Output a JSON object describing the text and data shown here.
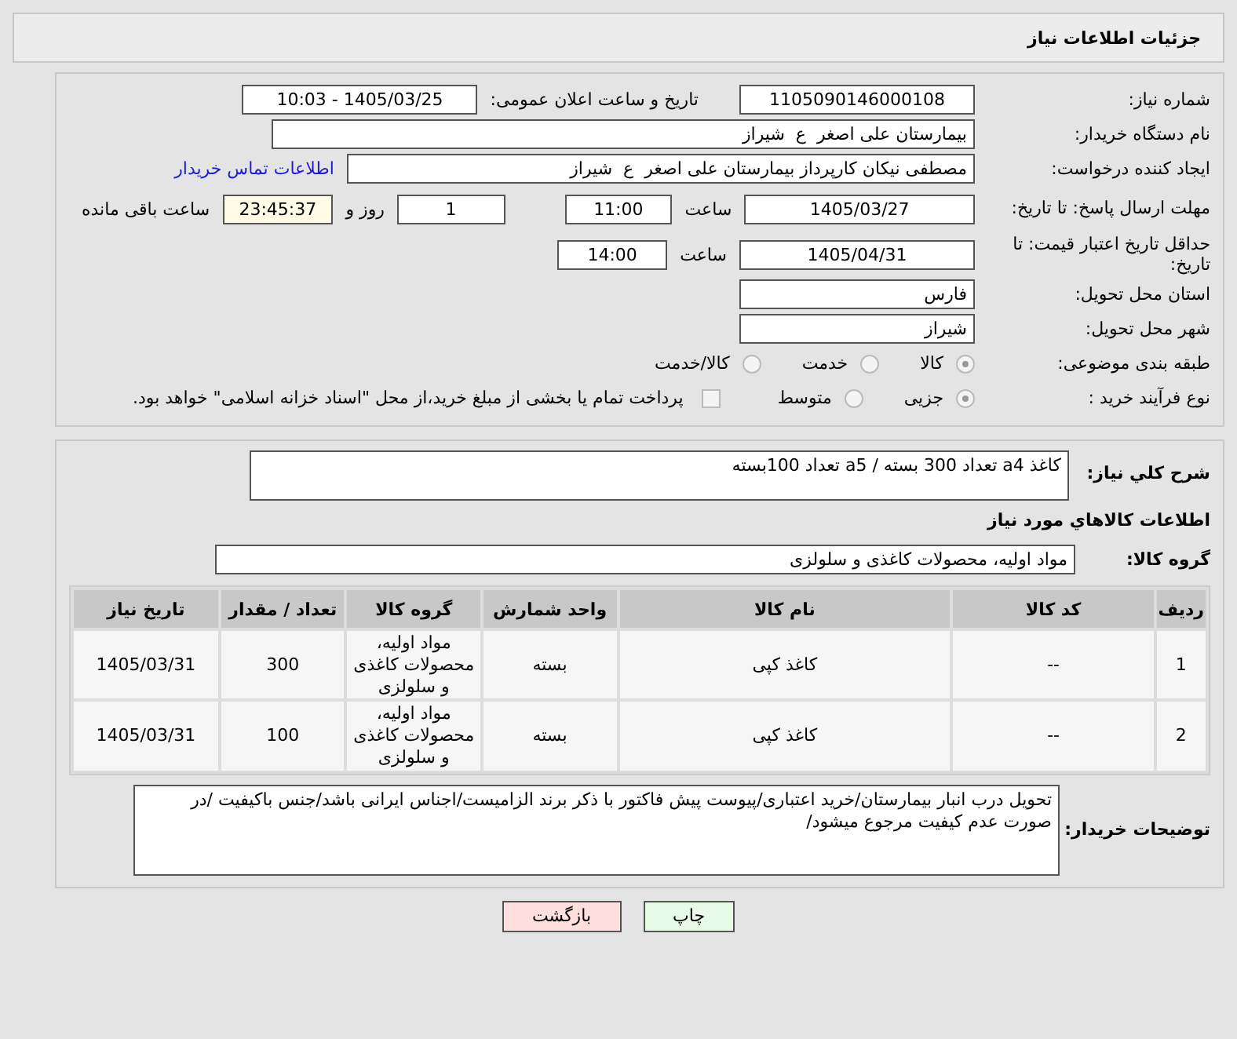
{
  "title": "جزئیات اطلاعات نیاز",
  "need_number": {
    "label": "شماره نیاز:",
    "value": "1105090146000108"
  },
  "announce": {
    "label": "تاریخ و ساعت اعلان عمومی:",
    "value": "1405/03/25 - 10:03"
  },
  "buyer": {
    "label": "نام دستگاه خریدار:",
    "value": "بیمارستان علی اصغر  ع  شیراز"
  },
  "requester": {
    "label": "ایجاد کننده درخواست:",
    "value": "مصطفی نیکان کارپرداز بیمارستان علی اصغر  ع  شیراز",
    "link": "اطلاعات تماس خریدار"
  },
  "deadline": {
    "label": "مهلت ارسال پاسخ: تا تاریخ:",
    "date": "1405/03/27",
    "time_label": "ساعت",
    "time": "11:00",
    "days": "1",
    "days_label": "روز و",
    "remaining": "23:45:37",
    "remaining_label": "ساعت باقی مانده"
  },
  "validity": {
    "label": "حداقل تاریخ اعتبار قیمت: تا تاریخ:",
    "date": "1405/04/31",
    "time_label": "ساعت",
    "time": "14:00"
  },
  "province": {
    "label": "استان محل تحویل:",
    "value": "فارس"
  },
  "city": {
    "label": "شهر محل تحویل:",
    "value": "شیراز"
  },
  "category": {
    "label": "طبقه بندی موضوعی:",
    "options": [
      {
        "label": "کالا",
        "selected": true
      },
      {
        "label": "خدمت",
        "selected": false
      },
      {
        "label": "کالا/خدمت",
        "selected": false
      }
    ]
  },
  "process": {
    "label": "نوع فرآیند خرید :",
    "options": [
      {
        "label": "جزیی",
        "selected": true
      },
      {
        "label": "متوسط",
        "selected": false
      }
    ],
    "payment": {
      "label": "پرداخت تمام یا بخشی از مبلغ خرید،از محل \"اسناد خزانه اسلامی\" خواهد بود.",
      "checked": false
    }
  },
  "description": {
    "label": "شرح کلي نياز:",
    "value": "کاغذ a4  تعداد 300 بسته / a5  تعداد 100بسته"
  },
  "goods_heading": "اطلاعات کالاهاي مورد نياز",
  "goods_group": {
    "label": "گروه کالا:",
    "value": "مواد اولیه، محصولات کاغذی و سلولزی"
  },
  "table": {
    "columns": [
      "ردیف",
      "کد کالا",
      "نام کالا",
      "واحد شمارش",
      "گروه کالا",
      "تعداد / مقدار",
      "تاریخ نیاز"
    ],
    "rows": [
      [
        "1",
        "--",
        "کاغذ کپی",
        "بسته",
        "مواد اولیه، محصولات کاغذی و سلولزی",
        "300",
        "1405/03/31"
      ],
      [
        "2",
        "--",
        "کاغذ کپی",
        "بسته",
        "مواد اولیه، محصولات کاغذی و سلولزی",
        "100",
        "1405/03/31"
      ]
    ]
  },
  "notes": {
    "label": "توضیحات خریدار:",
    "value": "تحویل درب انبار بیمارستان/خرید اعتباری/پیوست پیش فاکتور با ذکر برند الزامیست/اجناس ایرانی باشد/جنس باکیفیت /در صورت عدم کیفیت مرجوع میشود/"
  },
  "buttons": [
    {
      "label": "چاپ",
      "kind": "print"
    },
    {
      "label": "بازگشت",
      "kind": "back"
    }
  ]
}
